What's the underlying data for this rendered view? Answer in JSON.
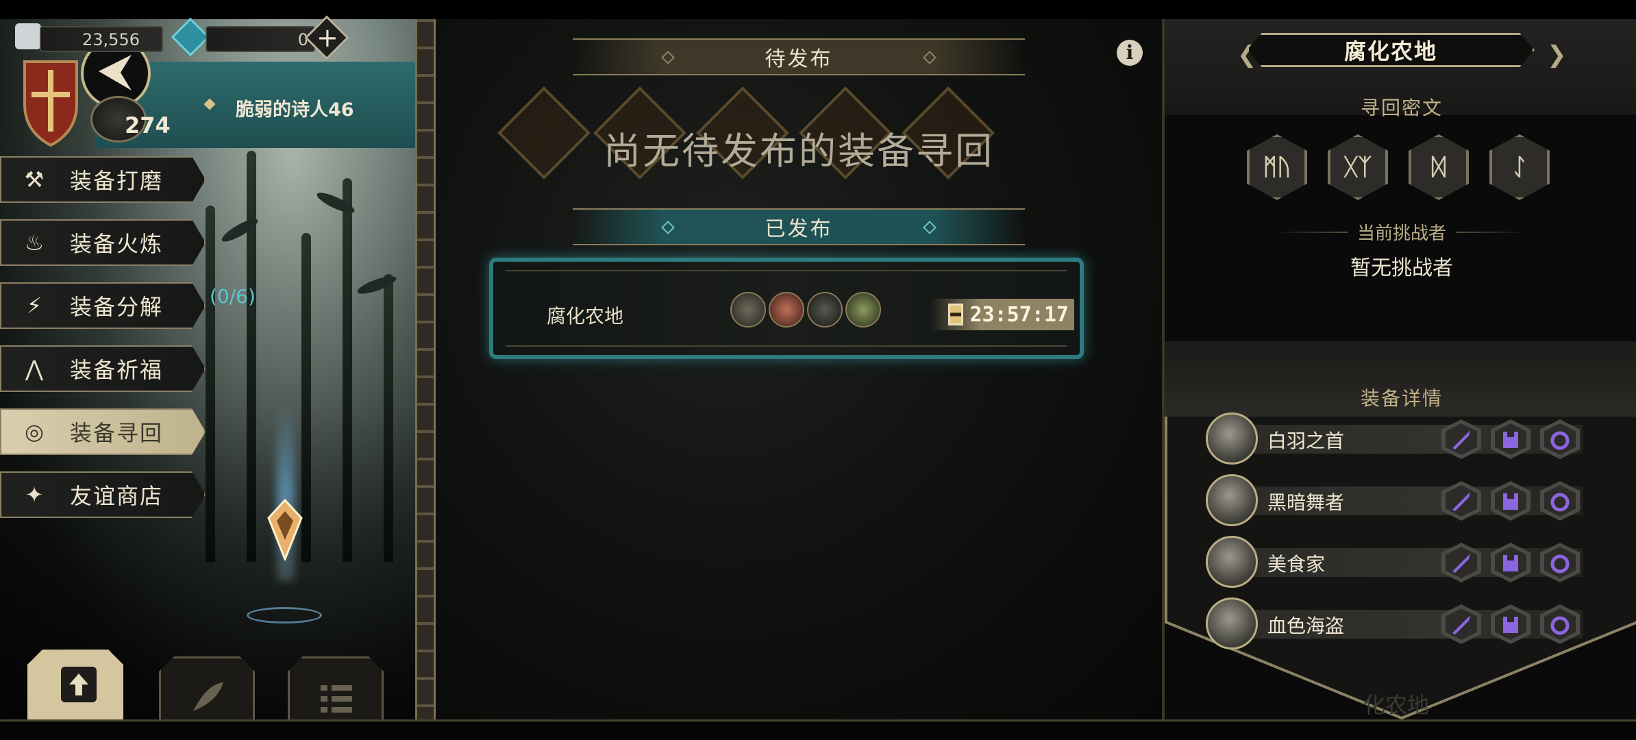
{
  "resources": {
    "gems": "23,556",
    "crystals": "0",
    "add_icon": "plus-icon"
  },
  "player": {
    "level": "274",
    "title": "脆弱的诗人46"
  },
  "menu": [
    {
      "label": "装备打磨",
      "icon": "hammer-icon"
    },
    {
      "label": "装备火炼",
      "icon": "flame-icon"
    },
    {
      "label": "装备分解",
      "icon": "disassemble-icon"
    },
    {
      "label": "装备祈福",
      "icon": "prayer-icon"
    },
    {
      "label": "装备寻回",
      "icon": "target-icon",
      "active": true
    },
    {
      "label": "友谊商店",
      "icon": "fox-icon"
    }
  ],
  "disassemble_count": "(0/6)",
  "bottom_tabs": [
    {
      "icon": "upload-icon",
      "active": true
    },
    {
      "icon": "feather-icon",
      "active": false
    },
    {
      "icon": "list-icon",
      "active": false
    }
  ],
  "center": {
    "pending_header": "待发布",
    "empty_message": "尚无待发布的装备寻回",
    "published_header": "已发布",
    "quest": {
      "name": "腐化农地",
      "timer": "23:57:17"
    }
  },
  "right": {
    "title": "腐化农地",
    "cipher_header": "寻回密文",
    "runes": [
      "ᛗᚢ",
      "ᚷᛉ",
      "ᛞ",
      "ᛇ"
    ],
    "challenger_header": "当前挑战者",
    "challenger_value": "暂无挑战者",
    "equip_header": "装备详情",
    "heroes": [
      {
        "name": "白羽之首"
      },
      {
        "name": "黑暗舞者"
      },
      {
        "name": "美食家"
      },
      {
        "name": "血色海盗"
      }
    ],
    "faded_footer": "化农地"
  },
  "colors": {
    "accent_teal": "#2e7a7e",
    "gold": "#bcae84",
    "slot_purple": "#8b66e0"
  }
}
